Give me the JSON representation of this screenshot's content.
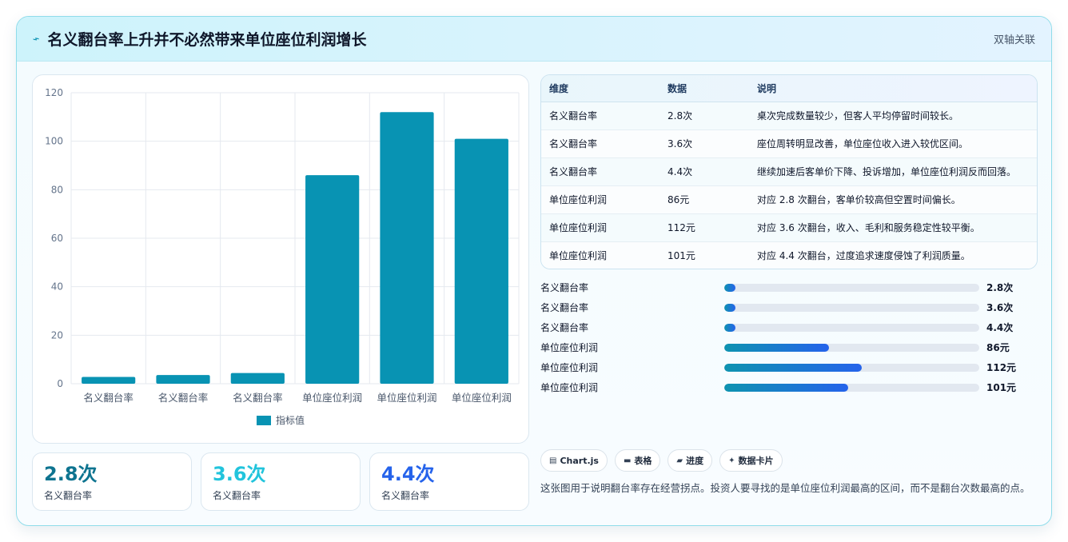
{
  "header": {
    "title": "名义翻台率上升并不必然带来单位座位利润增长",
    "tag": "双轴关联"
  },
  "chart_data": {
    "type": "bar",
    "categories": [
      "名义翻台率",
      "名义翻台率",
      "名义翻台率",
      "单位座位利润",
      "单位座位利润",
      "单位座位利润"
    ],
    "series": [
      {
        "name": "指标值",
        "values": [
          2.8,
          3.6,
          4.4,
          86,
          112,
          101
        ]
      }
    ],
    "ylim": [
      0,
      120
    ],
    "yticks": [
      0,
      20,
      40,
      60,
      80,
      100,
      120
    ],
    "grid": true,
    "legend": "bottom",
    "colors": {
      "bar": "#0893b3",
      "grid": "#e5e9ef",
      "tick": "#64748b"
    }
  },
  "kpis": [
    {
      "value": "2.8次",
      "label": "名义翻台率",
      "color": "#0e7490"
    },
    {
      "value": "3.6次",
      "label": "名义翻台率",
      "color": "#22c4dc"
    },
    {
      "value": "4.4次",
      "label": "名义翻台率",
      "color": "#2563eb"
    }
  ],
  "table": {
    "headers": [
      "维度",
      "数据",
      "说明"
    ],
    "rows": [
      [
        "名义翻台率",
        "2.8次",
        "桌次完成数量较少，但客人平均停留时间较长。"
      ],
      [
        "名义翻台率",
        "3.6次",
        "座位周转明显改善，单位座位收入进入较优区间。"
      ],
      [
        "名义翻台率",
        "4.4次",
        "继续加速后客单价下降、投诉增加，单位座位利润反而回落。"
      ],
      [
        "单位座位利润",
        "86元",
        "对应 2.8 次翻台，客单价较高但空置时间偏长。"
      ],
      [
        "单位座位利润",
        "112元",
        "对应 3.6 次翻台，收入、毛利和服务稳定性较平衡。"
      ],
      [
        "单位座位利润",
        "101元",
        "对应 4.4 次翻台，过度追求速度侵蚀了利润质量。"
      ]
    ]
  },
  "progress": [
    {
      "label": "名义翻台率",
      "value": "2.8次",
      "fraction": 0.043
    },
    {
      "label": "名义翻台率",
      "value": "3.6次",
      "fraction": 0.043
    },
    {
      "label": "名义翻台率",
      "value": "4.4次",
      "fraction": 0.043
    },
    {
      "label": "单位座位利润",
      "value": "86元",
      "fraction": 0.41
    },
    {
      "label": "单位座位利润",
      "value": "112元",
      "fraction": 0.54
    },
    {
      "label": "单位座位利润",
      "value": "101元",
      "fraction": 0.485
    }
  ],
  "tags": [
    {
      "icon": "chart-icon",
      "glyph": "▤",
      "label": "Chart.js"
    },
    {
      "icon": "table-icon",
      "glyph": "▬",
      "label": "表格"
    },
    {
      "icon": "progress-icon",
      "glyph": "▰",
      "label": "进度"
    },
    {
      "icon": "sparkle-icon",
      "glyph": "✦",
      "label": "数据卡片"
    }
  ],
  "note": "这张图用于说明翻台率存在经营拐点。投资人要寻找的是单位座位利润最高的区间，而不是翻台次数最高的点。"
}
